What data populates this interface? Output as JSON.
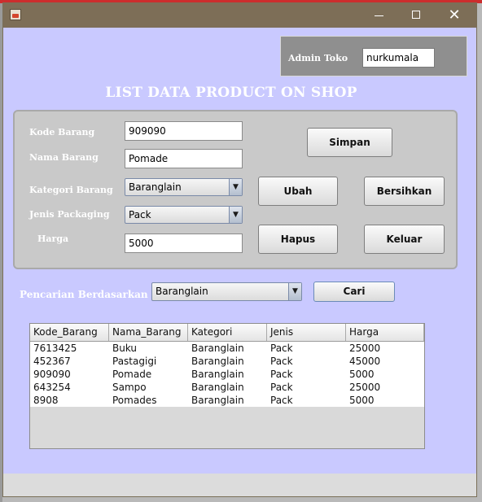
{
  "window": {
    "title": ""
  },
  "admin": {
    "label": "Admin Toko",
    "value": "nurkumala"
  },
  "page_title": "LIST DATA PRODUCT ON SHOP",
  "form": {
    "kode_label": "Kode Barang",
    "kode_value": "909090",
    "nama_label": "Nama Barang",
    "nama_value": "Pomade",
    "kategori_label": "Kategori Barang",
    "kategori_value": "Baranglain",
    "packaging_label": "Jenis Packaging",
    "packaging_value": "Pack",
    "harga_label": "Harga",
    "harga_value": "5000"
  },
  "buttons": {
    "simpan": "Simpan",
    "ubah": "Ubah",
    "bersihkan": "Bersihkan",
    "hapus": "Hapus",
    "keluar": "Keluar",
    "cari": "Cari"
  },
  "search": {
    "label": "Pencarian Berdasarkan",
    "value": "Baranglain"
  },
  "table": {
    "headers": [
      "Kode_Barang",
      "Nama_Barang",
      "Kategori",
      "Jenis",
      "Harga"
    ],
    "rows": [
      [
        "7613425",
        "Buku",
        "Baranglain",
        "Pack",
        "25000"
      ],
      [
        "452367",
        "Pastagigi",
        "Baranglain",
        "Pack",
        "45000"
      ],
      [
        "909090",
        "Pomade",
        "Baranglain",
        "Pack",
        "5000"
      ],
      [
        "643254",
        "Sampo",
        "Baranglain",
        "Pack",
        "25000"
      ],
      [
        "8908",
        "Pomades",
        "Baranglain",
        "Pack",
        "5000"
      ]
    ]
  },
  "icons": {
    "app": "java-app-icon",
    "minimize": "minimize-icon",
    "maximize": "maximize-icon",
    "close": "close-icon",
    "dropdown": "chevron-down-icon"
  },
  "colors": {
    "titlebar": "#7d6e57",
    "window_bg": "#c9c9ff",
    "panel_bg": "#c9c9c9",
    "admin_panel_bg": "#8f8f8f"
  }
}
